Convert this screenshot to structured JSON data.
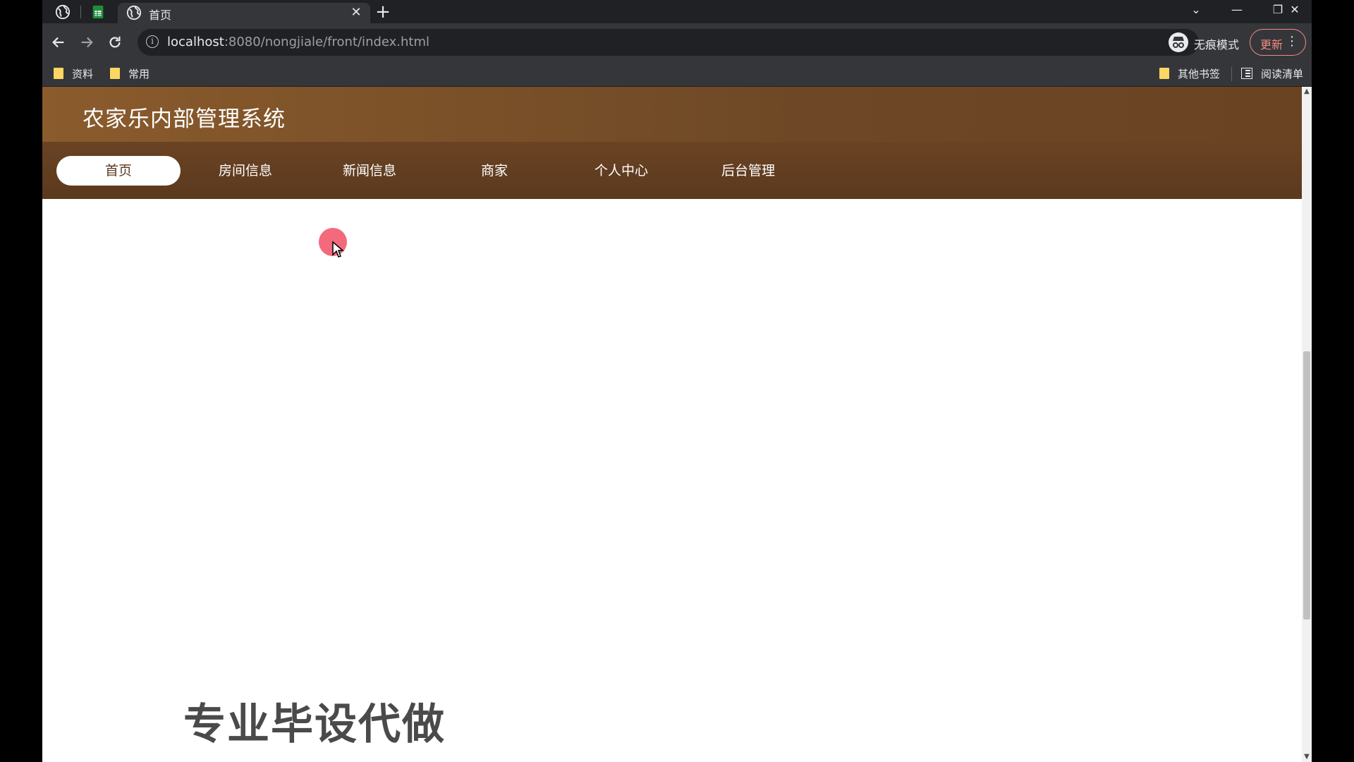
{
  "browser": {
    "tabs": [
      {
        "title": "首页",
        "close": "✕"
      }
    ],
    "new_tab": "+",
    "window_controls": {
      "list": "⌄",
      "minimize": "—",
      "restore": "❐",
      "close": "✕"
    },
    "url_host": "localhost",
    "url_rest": ":8080/nongjiale/front/index.html",
    "incognito_label": "无痕模式",
    "update_label": "更新",
    "menu_glyph": "⋮",
    "star_glyph": "☆",
    "bookmarks": {
      "left": [
        "资料",
        "常用"
      ],
      "right": [
        "其他书签",
        "阅读清单"
      ]
    }
  },
  "site": {
    "title": "农家乐内部管理系统",
    "nav": [
      "首页",
      "房间信息",
      "新闻信息",
      "商家",
      "个人中心",
      "后台管理"
    ],
    "active_nav": "首页",
    "watermark": "专业毕设代做"
  },
  "colors": {
    "header": "#7a5128",
    "nav": "#5b391e",
    "cursor": "#f05064"
  }
}
